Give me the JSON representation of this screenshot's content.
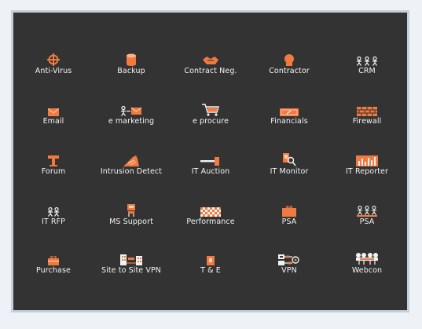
{
  "accent_color": "#f07a40",
  "background_color": "#333333",
  "icons": [
    {
      "label": "Anti-Virus",
      "icon": "crosshair-icon"
    },
    {
      "label": "Backup",
      "icon": "database-icon"
    },
    {
      "label": "Contract Neg.",
      "icon": "handshake-icon"
    },
    {
      "label": "Contractor",
      "icon": "person-head-icon"
    },
    {
      "label": "CRM",
      "icon": "people-group-icon"
    },
    {
      "label": "Email",
      "icon": "envelope-icon"
    },
    {
      "label": "e marketing",
      "icon": "person-envelope-icon"
    },
    {
      "label": "e procure",
      "icon": "shopping-cart-icon"
    },
    {
      "label": "Financials",
      "icon": "check-banknote-icon"
    },
    {
      "label": "Firewall",
      "icon": "brick-wall-icon"
    },
    {
      "label": "Forum",
      "icon": "podium-icon"
    },
    {
      "label": "Intrusion Detect",
      "icon": "intrusion-icon"
    },
    {
      "label": "IT Auction",
      "icon": "gavel-icon"
    },
    {
      "label": "IT Monitor",
      "icon": "monitor-search-icon"
    },
    {
      "label": "IT Reporter",
      "icon": "bar-chart-icon"
    },
    {
      "label": "IT RFP",
      "icon": "two-people-icon"
    },
    {
      "label": "MS Support",
      "icon": "support-person-icon"
    },
    {
      "label": "Performance",
      "icon": "checkered-flag-icon"
    },
    {
      "label": "PSA",
      "icon": "briefcase-icon"
    },
    {
      "label": "PSA",
      "icon": "team-icon"
    },
    {
      "label": "Purchase",
      "icon": "shopping-bag-icon"
    },
    {
      "label": "Site to Site VPN",
      "icon": "buildings-icon"
    },
    {
      "label": "T & E",
      "icon": "receipt-icon"
    },
    {
      "label": "VPN",
      "icon": "vpn-key-icon"
    },
    {
      "label": "Webcon",
      "icon": "web-conference-icon"
    }
  ]
}
